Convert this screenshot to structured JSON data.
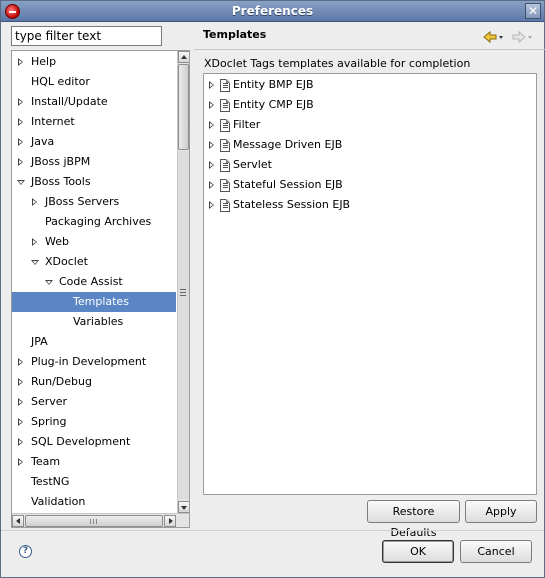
{
  "window": {
    "title": "Preferences"
  },
  "filter": {
    "placeholder": "type filter text",
    "value": "type filter text"
  },
  "tree": [
    {
      "label": "Help",
      "indent": 0,
      "twisty": "closed"
    },
    {
      "label": "HQL editor",
      "indent": 0,
      "twisty": "none"
    },
    {
      "label": "Install/Update",
      "indent": 0,
      "twisty": "closed"
    },
    {
      "label": "Internet",
      "indent": 0,
      "twisty": "closed"
    },
    {
      "label": "Java",
      "indent": 0,
      "twisty": "closed"
    },
    {
      "label": "JBoss jBPM",
      "indent": 0,
      "twisty": "closed"
    },
    {
      "label": "JBoss Tools",
      "indent": 0,
      "twisty": "open"
    },
    {
      "label": "JBoss Servers",
      "indent": 1,
      "twisty": "closed"
    },
    {
      "label": "Packaging Archives",
      "indent": 1,
      "twisty": "none"
    },
    {
      "label": "Web",
      "indent": 1,
      "twisty": "closed"
    },
    {
      "label": "XDoclet",
      "indent": 1,
      "twisty": "open"
    },
    {
      "label": "Code Assist",
      "indent": 2,
      "twisty": "open"
    },
    {
      "label": "Templates",
      "indent": 3,
      "twisty": "none",
      "selected": true
    },
    {
      "label": "Variables",
      "indent": 3,
      "twisty": "none"
    },
    {
      "label": "JPA",
      "indent": 0,
      "twisty": "none"
    },
    {
      "label": "Plug-in Development",
      "indent": 0,
      "twisty": "closed"
    },
    {
      "label": "Run/Debug",
      "indent": 0,
      "twisty": "closed"
    },
    {
      "label": "Server",
      "indent": 0,
      "twisty": "closed"
    },
    {
      "label": "Spring",
      "indent": 0,
      "twisty": "closed"
    },
    {
      "label": "SQL Development",
      "indent": 0,
      "twisty": "closed"
    },
    {
      "label": "Team",
      "indent": 0,
      "twisty": "closed"
    },
    {
      "label": "TestNG",
      "indent": 0,
      "twisty": "none"
    },
    {
      "label": "Validation",
      "indent": 0,
      "twisty": "none"
    }
  ],
  "page": {
    "title": "Templates",
    "description": "XDoclet Tags templates available for completion",
    "templates": [
      "Entity BMP EJB",
      "Entity CMP EJB",
      "Filter",
      "Message Driven EJB",
      "Servlet",
      "Stateful Session EJB",
      "Stateless Session EJB"
    ]
  },
  "buttons": {
    "restore_defaults": "Restore Defaults",
    "apply": "Apply",
    "ok": "OK",
    "cancel": "Cancel"
  },
  "icons": {
    "back": "arrow-left-icon",
    "forward": "arrow-right-icon",
    "help": "help-icon",
    "template": "template-file-icon"
  },
  "colors": {
    "selection": "#5a86c6",
    "titlebar": "#6f88b6",
    "background": "#ededed"
  }
}
